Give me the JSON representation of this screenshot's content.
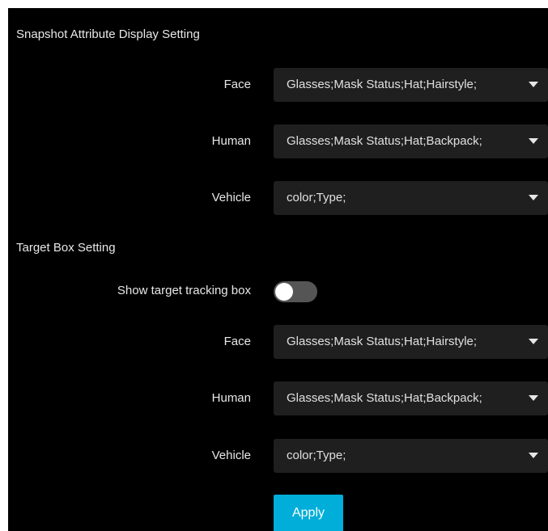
{
  "snapshot_section": {
    "title": "Snapshot Attribute Display Setting",
    "rows": [
      {
        "label": "Face",
        "value": "Glasses;Mask Status;Hat;Hairstyle;"
      },
      {
        "label": "Human",
        "value": "Glasses;Mask Status;Hat;Backpack;"
      },
      {
        "label": "Vehicle",
        "value": "color;Type;"
      }
    ]
  },
  "target_box_section": {
    "title": "Target Box Setting",
    "toggle_label": "Show target tracking box",
    "toggle_state": "off",
    "rows": [
      {
        "label": "Face",
        "value": "Glasses;Mask Status;Hat;Hairstyle;"
      },
      {
        "label": "Human",
        "value": "Glasses;Mask Status;Hat;Backpack;"
      },
      {
        "label": "Vehicle",
        "value": "color;Type;"
      }
    ]
  },
  "actions": {
    "apply_label": "Apply"
  },
  "colors": {
    "background": "#000000",
    "select_background": "#1f1f1f",
    "toggle_off": "#555555",
    "accent": "#00aed9"
  },
  "icons": {
    "dropdown": "caret-down-icon",
    "toggle_knob": "toggle-knob"
  }
}
